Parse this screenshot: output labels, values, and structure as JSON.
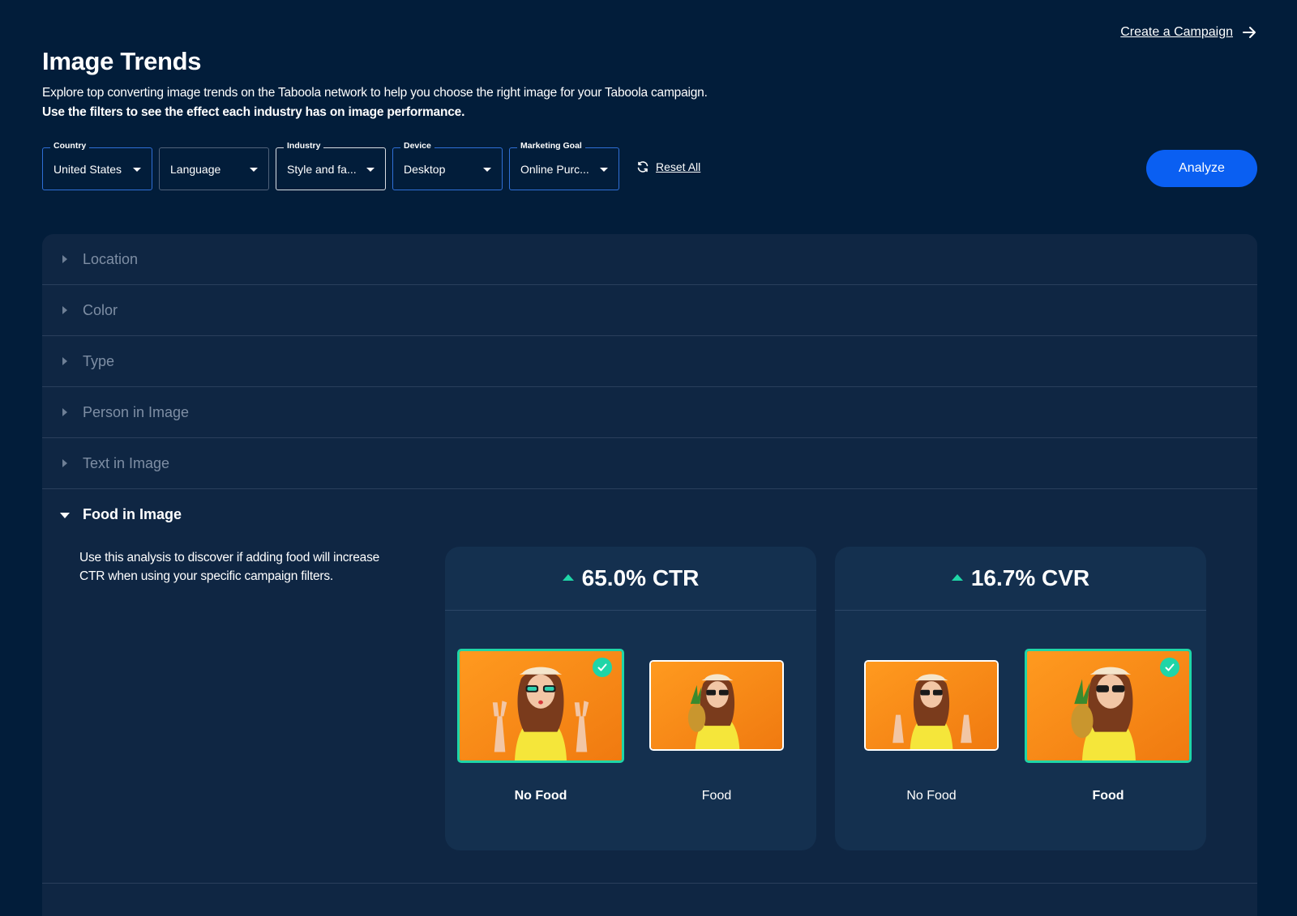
{
  "header": {
    "create_link": "Create a Campaign",
    "title": "Image Trends",
    "description_1": "Explore top converting image trends on the Taboola network to help you choose the right image for your Taboola campaign.",
    "description_2": "Use the filters to see the effect each industry has on image performance."
  },
  "filters": [
    {
      "legend": "Country",
      "value": "United States"
    },
    {
      "legend": "",
      "value": "Language"
    },
    {
      "legend": "Industry",
      "value": "Style and fa..."
    },
    {
      "legend": "Device",
      "value": "Desktop"
    },
    {
      "legend": "Marketing Goal",
      "value": "Online Purc..."
    }
  ],
  "reset_label": "Reset All",
  "analyze_label": "Analyze",
  "accordion": [
    {
      "label": "Location",
      "open": false
    },
    {
      "label": "Color",
      "open": false
    },
    {
      "label": "Type",
      "open": false
    },
    {
      "label": "Person in Image",
      "open": false
    },
    {
      "label": "Text in Image",
      "open": false
    },
    {
      "label": "Food in Image",
      "open": true
    }
  ],
  "food_section": {
    "description": "Use this analysis to discover if adding food will increase CTR when using your specific campaign filters.",
    "cards": [
      {
        "metric": "65.0% CTR",
        "trend": "up",
        "options": [
          {
            "label": "No Food",
            "selected": true,
            "image": "woman-peace-sign-orange"
          },
          {
            "label": "Food",
            "selected": false,
            "image": "woman-pineapple-orange"
          }
        ]
      },
      {
        "metric": "16.7% CVR",
        "trend": "up",
        "options": [
          {
            "label": "No Food",
            "selected": false,
            "image": "woman-peace-sign-orange"
          },
          {
            "label": "Food",
            "selected": true,
            "image": "woman-pineapple-orange"
          }
        ]
      }
    ]
  },
  "colors": {
    "background": "#021d3a",
    "panel": "#0f2643",
    "card": "#14304f",
    "accent": "#0a5ff2",
    "success": "#1fd5a7"
  }
}
